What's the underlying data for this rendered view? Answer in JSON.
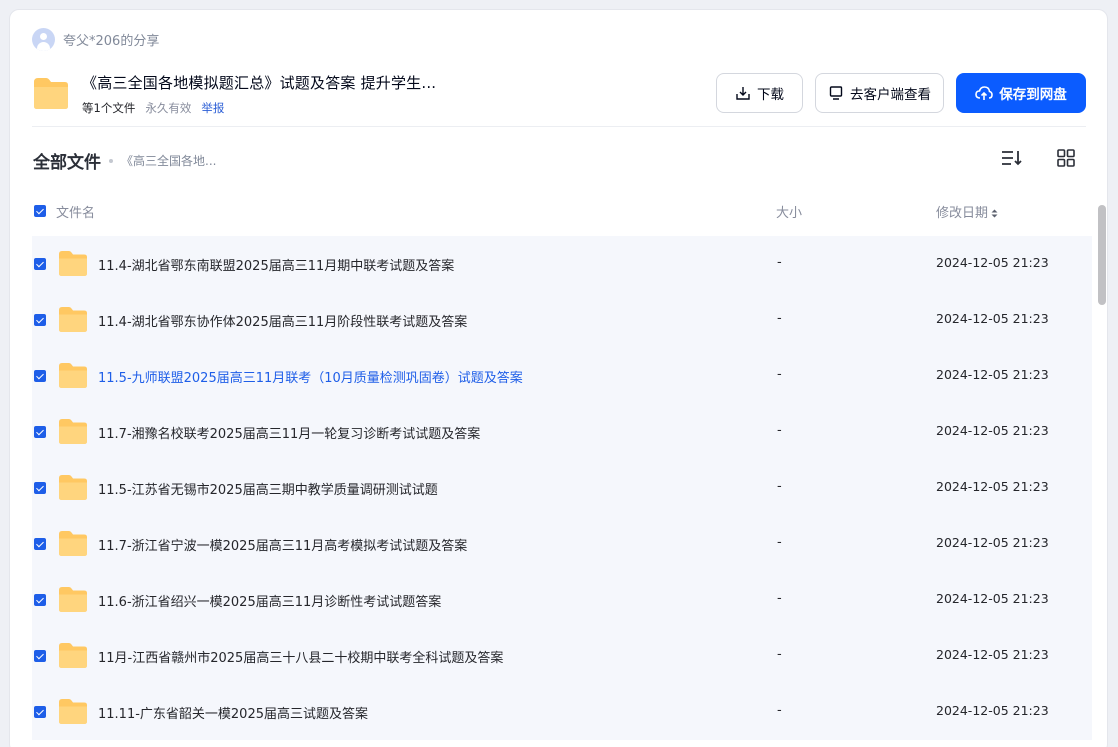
{
  "sharer": {
    "text": "夸父*206的分享"
  },
  "share": {
    "title": "《高三全国各地模拟题汇总》试题及答案 提升学生...",
    "file_count": "等1个文件",
    "validity": "永久有效",
    "report": "举报"
  },
  "buttons": {
    "download": "下载",
    "client_view": "去客户端查看",
    "save": "保存到网盘"
  },
  "breadcrumb": {
    "root": "全部文件",
    "current": "《高三全国各地..."
  },
  "table": {
    "headers": {
      "name": "文件名",
      "size": "大小",
      "date": "修改日期"
    },
    "rows": [
      {
        "name": "11.4-湖北省鄂东南联盟2025届高三11月期中联考试题及答案",
        "size": "-",
        "date": "2024-12-05 21:23"
      },
      {
        "name": "11.4-湖北省鄂东协作体2025届高三11月阶段性联考试题及答案",
        "size": "-",
        "date": "2024-12-05 21:23"
      },
      {
        "name": "11.5-九师联盟2025届高三11月联考（10月质量检测巩固卷）试题及答案",
        "size": "-",
        "date": "2024-12-05 21:23"
      },
      {
        "name": "11.7-湘豫名校联考2025届高三11月一轮复习诊断考试试题及答案",
        "size": "-",
        "date": "2024-12-05 21:23"
      },
      {
        "name": "11.5-江苏省无锡市2025届高三期中教学质量调研测试试题",
        "size": "-",
        "date": "2024-12-05 21:23"
      },
      {
        "name": "11.7-浙江省宁波一模2025届高三11月高考模拟考试试题及答案",
        "size": "-",
        "date": "2024-12-05 21:23"
      },
      {
        "name": "11.6-浙江省绍兴一模2025届高三11月诊断性考试试题答案",
        "size": "-",
        "date": "2024-12-05 21:23"
      },
      {
        "name": "11月-江西省赣州市2025届高三十八县二十校期中联考全科试题及答案",
        "size": "-",
        "date": "2024-12-05 21:23"
      },
      {
        "name": "11.11-广东省韶关一模2025届高三试题及答案",
        "size": "-",
        "date": "2024-12-05 21:23"
      }
    ]
  },
  "colors": {
    "primary": "#0b5cff",
    "checkbox": "#1e5ee8",
    "folder": "#ffc862",
    "row_bg": "#f5f7fc"
  },
  "icons": {
    "avatar": "user-avatar-icon",
    "folder": "folder-icon",
    "download": "download-icon",
    "client": "monitor-icon",
    "save": "cloud-upload-icon",
    "sort": "sort-list-icon",
    "grid": "grid-view-icon"
  }
}
